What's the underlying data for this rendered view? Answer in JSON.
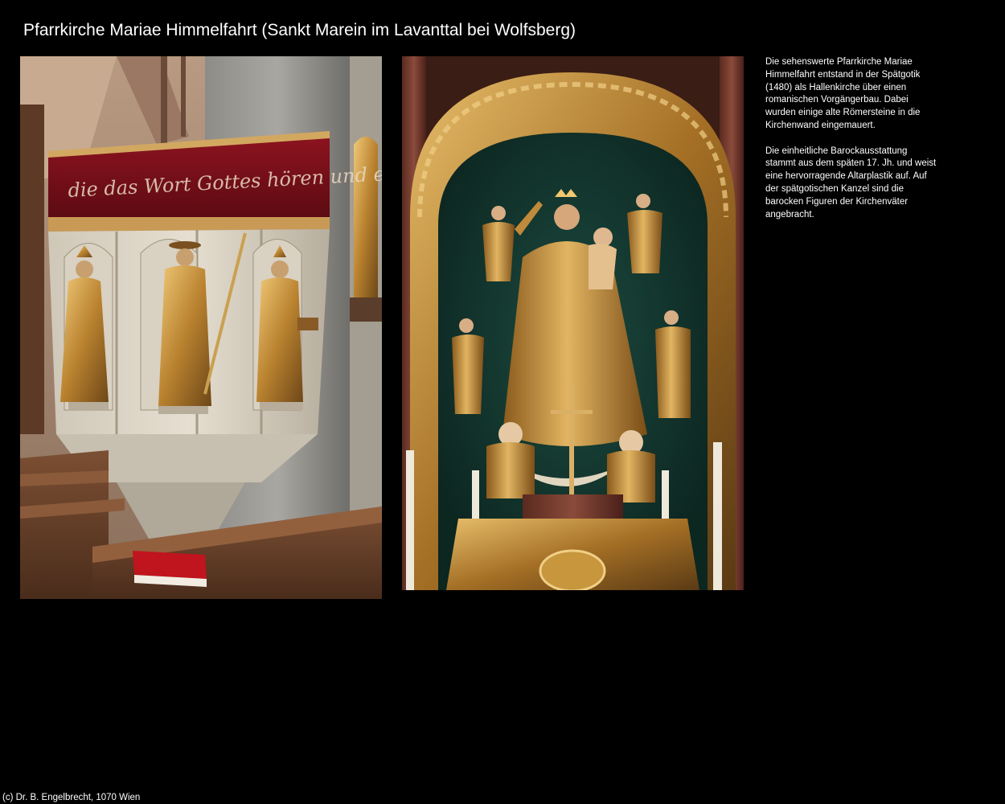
{
  "page": {
    "title": "Pfarrkirche Mariae Himmelfahrt (Sankt Marein im Lavanttal bei Wolfsberg)",
    "copyright": "(c) Dr. B. Engelbrecht, 1070 Wien"
  },
  "description": {
    "paragraph_1": "Die sehenswerte Pfarrkirche Mariae Himmelfahrt entstand in der Spätgotik (1480) als Hallenkirche über einen romanischen Vorgängerbau. Dabei wurden einige alte Römersteine in die Kirchenwand eingemauert.",
    "paragraph_2": "Die einheitliche Barockausstattung stammt aus dem späten 17. Jh. und weist eine hervorragende Altarplastik auf. Auf der spätgotischen Kanzel sind die barocken Figuren der Kirchenväter angebracht."
  },
  "photos": {
    "pulpit": {
      "banner_text": "die das Wort Gottes hören und es befolgen"
    },
    "altar": {}
  },
  "colors": {
    "background": "#000000",
    "text": "#ffffff",
    "gold": "#c8963c",
    "velvet_red": "#7a0e18",
    "altar_green": "#123a32"
  }
}
